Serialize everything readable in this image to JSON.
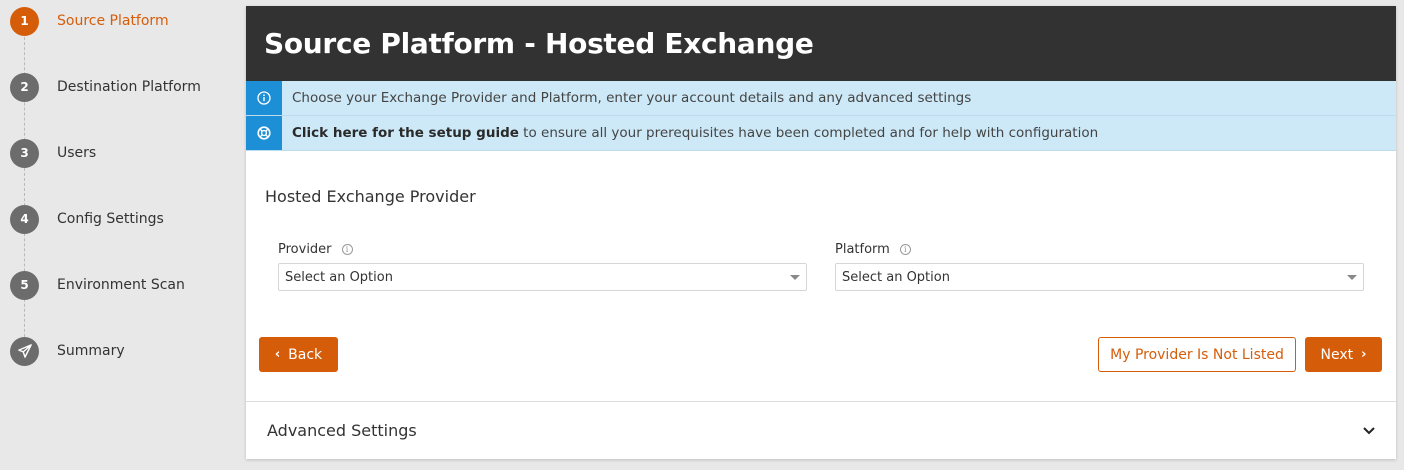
{
  "sidebar": {
    "steps": [
      {
        "num": "1",
        "label": "Source Platform",
        "active": true
      },
      {
        "num": "2",
        "label": "Destination Platform"
      },
      {
        "num": "3",
        "label": "Users"
      },
      {
        "num": "4",
        "label": "Config Settings"
      },
      {
        "num": "5",
        "label": "Environment Scan"
      },
      {
        "num": "",
        "label": "Summary",
        "icon": "paper-plane-icon"
      }
    ]
  },
  "header": {
    "title": "Source Platform - Hosted Exchange"
  },
  "info": {
    "line1": "Choose your Exchange Provider and Platform, enter your account details and any advanced settings",
    "line2_link": "Click here for the setup guide",
    "line2_rest": " to ensure all your prerequisites have been completed and for help with configuration",
    "line1_icon": "info-circle-icon",
    "line2_icon": "lifebuoy-icon"
  },
  "form": {
    "section_title": "Hosted Exchange Provider",
    "provider": {
      "label": "Provider",
      "value": "Select an Option"
    },
    "platform": {
      "label": "Platform",
      "value": "Select an Option"
    }
  },
  "actions": {
    "back": "Back",
    "not_listed": "My Provider Is Not Listed",
    "next": "Next"
  },
  "advanced": {
    "label": "Advanced Settings"
  },
  "colors": {
    "accent": "#d55d0a",
    "header_bg": "#323232",
    "info_bg": "#cde9f7",
    "info_icon_bg": "#1d8fd6"
  }
}
